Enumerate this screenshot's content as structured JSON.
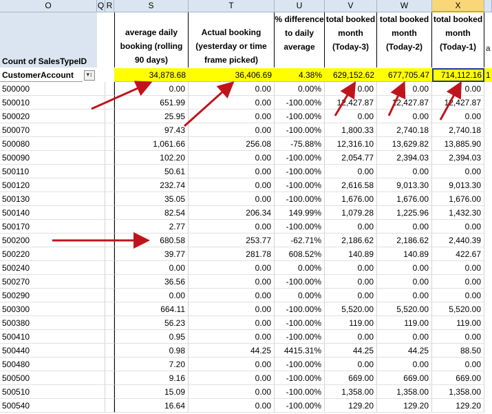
{
  "columns": [
    "O",
    "Q",
    "R",
    "S",
    "T",
    "U",
    "V",
    "W",
    "X"
  ],
  "header_labels": {
    "O_top": "Count of SalesTypeID",
    "O_bottom": "CustomerAccount",
    "S": "average daily booking (rolling 90 days)",
    "T": "Actual booking (yesterday or time frame picked)",
    "U": "% difference to daily average",
    "V": "total booked month (Today-3)",
    "W": "total booked month (Today-2)",
    "X": "total booked month (Today-1)",
    "Y_partial": "a",
    "totals_partial": "1"
  },
  "filter_icon": "filter-sort-icon",
  "totals": [
    "34,878.68",
    "36,406.69",
    "4.38%",
    "629,152.62",
    "677,705.47",
    "714,112.16"
  ],
  "rows": [
    [
      "500000",
      "0.00",
      "0.00",
      "0.00%",
      "0.00",
      "0.00",
      "0.00"
    ],
    [
      "500010",
      "651.99",
      "0.00",
      "-100.00%",
      "12,427.87",
      "12,427.87",
      "12,427.87"
    ],
    [
      "500020",
      "25.95",
      "0.00",
      "-100.00%",
      "0.00",
      "0.00",
      "0.00"
    ],
    [
      "500070",
      "97.43",
      "0.00",
      "-100.00%",
      "1,800.33",
      "2,740.18",
      "2,740.18"
    ],
    [
      "500080",
      "1,061.66",
      "256.08",
      "-75.88%",
      "12,316.10",
      "13,629.82",
      "13,885.90"
    ],
    [
      "500090",
      "102.20",
      "0.00",
      "-100.00%",
      "2,054.77",
      "2,394.03",
      "2,394.03"
    ],
    [
      "500110",
      "50.61",
      "0.00",
      "-100.00%",
      "0.00",
      "0.00",
      "0.00"
    ],
    [
      "500120",
      "232.74",
      "0.00",
      "-100.00%",
      "2,616.58",
      "9,013.30",
      "9,013.30"
    ],
    [
      "500130",
      "35.05",
      "0.00",
      "-100.00%",
      "1,676.00",
      "1,676.00",
      "1,676.00"
    ],
    [
      "500140",
      "82.54",
      "206.34",
      "149.99%",
      "1,079.28",
      "1,225.96",
      "1,432.30"
    ],
    [
      "500170",
      "2.77",
      "0.00",
      "-100.00%",
      "0.00",
      "0.00",
      "0.00"
    ],
    [
      "500200",
      "680.58",
      "253.77",
      "-62.71%",
      "2,186.62",
      "2,186.62",
      "2,440.39"
    ],
    [
      "500220",
      "39.77",
      "281.78",
      "608.52%",
      "140.89",
      "140.89",
      "422.67"
    ],
    [
      "500240",
      "0.00",
      "0.00",
      "0.00%",
      "0.00",
      "0.00",
      "0.00"
    ],
    [
      "500270",
      "36.56",
      "0.00",
      "-100.00%",
      "0.00",
      "0.00",
      "0.00"
    ],
    [
      "500290",
      "0.00",
      "0.00",
      "0.00%",
      "0.00",
      "0.00",
      "0.00"
    ],
    [
      "500300",
      "664.11",
      "0.00",
      "-100.00%",
      "5,520.00",
      "5,520.00",
      "5,520.00"
    ],
    [
      "500380",
      "56.23",
      "0.00",
      "-100.00%",
      "119.00",
      "119.00",
      "119.00"
    ],
    [
      "500410",
      "0.95",
      "0.00",
      "-100.00%",
      "0.00",
      "0.00",
      "0.00"
    ],
    [
      "500440",
      "0.98",
      "44.25",
      "4415.31%",
      "44.25",
      "44.25",
      "88.50"
    ],
    [
      "500480",
      "7.20",
      "0.00",
      "-100.00%",
      "0.00",
      "0.00",
      "0.00"
    ],
    [
      "500500",
      "9.16",
      "0.00",
      "-100.00%",
      "669.00",
      "669.00",
      "669.00"
    ],
    [
      "500510",
      "15.09",
      "0.00",
      "-100.00%",
      "1,358.00",
      "1,358.00",
      "1,358.00"
    ],
    [
      "500540",
      "16.64",
      "0.00",
      "-100.00%",
      "129.20",
      "129.20",
      "129.20"
    ]
  ],
  "colors": {
    "highlight": "#ffff00",
    "column_header_bg": "#dbe5f1",
    "selected_column_header": "#f9d778",
    "arrow": "#c0141c",
    "selected_cell_border": "#1f3b8f"
  }
}
